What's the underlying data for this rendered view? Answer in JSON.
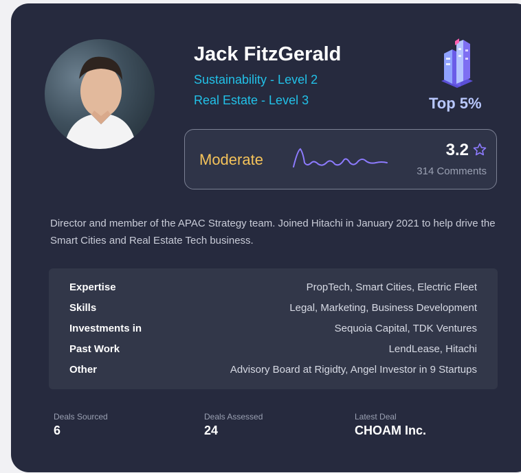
{
  "profile": {
    "name": "Jack FitzGerald",
    "levels": [
      "Sustainability - Level 2",
      "Real Estate - Level 3"
    ],
    "rank_label": "Top 5%",
    "rank_icon": "building-icon"
  },
  "rating": {
    "mood": "Moderate",
    "score": "3.2",
    "comments": "314 Comments"
  },
  "bio": "Director and member of the APAC Strategy team. Joined Hitachi in January 2021 to help drive the Smart Cities and Real Estate Tech business.",
  "details": [
    {
      "label": "Expertise",
      "value": "PropTech, Smart Cities, Electric Fleet"
    },
    {
      "label": "Skills",
      "value": "Legal, Marketing, Business Development"
    },
    {
      "label": "Investments in",
      "value": "Sequoia Capital, TDK Ventures"
    },
    {
      "label": "Past Work",
      "value": "LendLease, Hitachi"
    },
    {
      "label": "Other",
      "value": "Advisory Board at Rigidty, Angel Investor in 9 Startups"
    }
  ],
  "stats": [
    {
      "label": "Deals Sourced",
      "value": "6"
    },
    {
      "label": "Deals Assessed",
      "value": "24"
    },
    {
      "label": "Latest Deal",
      "value": "CHOAM Inc."
    }
  ],
  "colors": {
    "card_bg": "#262a3e",
    "level_text": "#22c1e8",
    "mood_text": "#f5c35a",
    "accent_purple": "#8d7bff"
  }
}
